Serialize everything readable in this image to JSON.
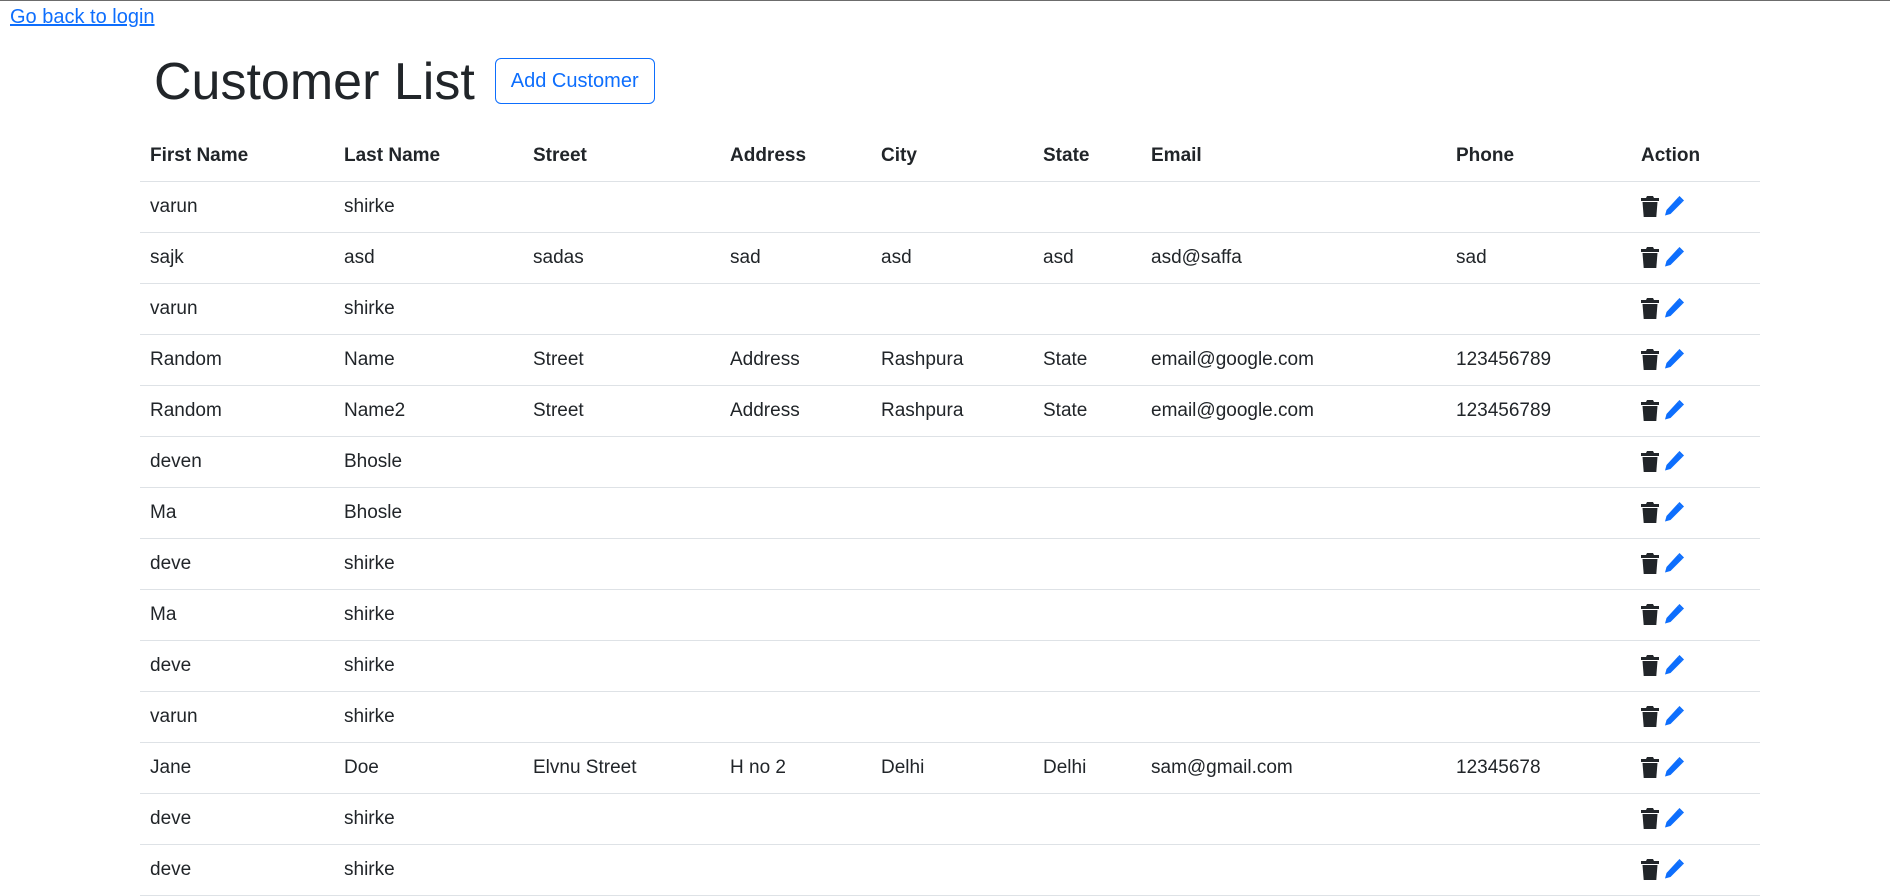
{
  "nav": {
    "back_link": "Go back to login"
  },
  "page": {
    "title": "Customer List",
    "add_button": "Add Customer"
  },
  "table": {
    "headers": [
      "First Name",
      "Last Name",
      "Street",
      "Address",
      "City",
      "State",
      "Email",
      "Phone",
      "Action"
    ],
    "rows": [
      [
        "varun",
        "shirke",
        "",
        "",
        "",
        "",
        "",
        ""
      ],
      [
        "sajk",
        "asd",
        "sadas",
        "sad",
        "asd",
        "asd",
        "asd@saffa",
        "sad"
      ],
      [
        "varun",
        "shirke",
        "",
        "",
        "",
        "",
        "",
        ""
      ],
      [
        "Random",
        "Name",
        "Street",
        "Address",
        "Rashpura",
        "State",
        "email@google.com",
        "123456789"
      ],
      [
        "Random",
        "Name2",
        "Street",
        "Address",
        "Rashpura",
        "State",
        "email@google.com",
        "123456789"
      ],
      [
        "deven",
        "Bhosle",
        "",
        "",
        "",
        "",
        "",
        ""
      ],
      [
        "Ma",
        "Bhosle",
        "",
        "",
        "",
        "",
        "",
        ""
      ],
      [
        "deve",
        "shirke",
        "",
        "",
        "",
        "",
        "",
        ""
      ],
      [
        "Ma",
        "shirke",
        "",
        "",
        "",
        "",
        "",
        ""
      ],
      [
        "deve",
        "shirke",
        "",
        "",
        "",
        "",
        "",
        ""
      ],
      [
        "varun",
        "shirke",
        "",
        "",
        "",
        "",
        "",
        ""
      ],
      [
        "Jane",
        "Doe",
        "Elvnu Street",
        "H no 2",
        "Delhi",
        "Delhi",
        "sam@gmail.com",
        "12345678"
      ],
      [
        "deve",
        "shirke",
        "",
        "",
        "",
        "",
        "",
        ""
      ],
      [
        "deve",
        "shirke",
        "",
        "",
        "",
        "",
        "",
        ""
      ]
    ],
    "action_icons": {
      "delete": "trash-icon",
      "edit": "pencil-icon"
    }
  },
  "colors": {
    "link": "#0d6efd",
    "text": "#212529",
    "border": "#dee2e6",
    "delete_icon": "#212529",
    "edit_icon": "#0d6efd"
  }
}
